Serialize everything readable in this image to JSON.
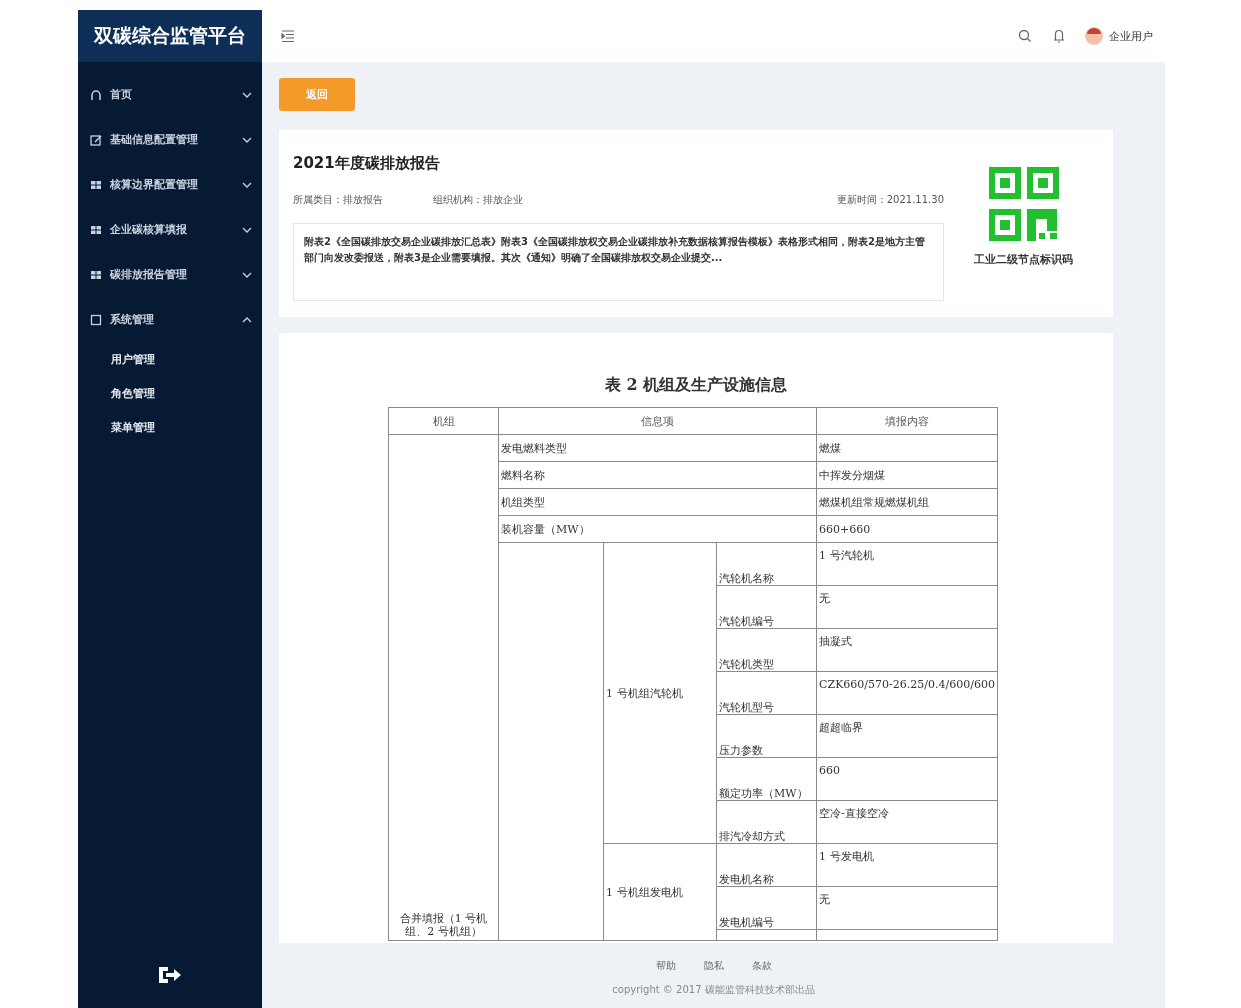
{
  "sidebar": {
    "title": "双碳综合监管平台",
    "items": [
      {
        "label": "首页",
        "expanded": false
      },
      {
        "label": "基础信息配置管理",
        "expanded": false
      },
      {
        "label": "核算边界配置管理",
        "expanded": false
      },
      {
        "label": "企业碳核算填报",
        "expanded": false
      },
      {
        "label": "碳排放报告管理",
        "expanded": false
      },
      {
        "label": "系统管理",
        "expanded": true,
        "children": [
          {
            "label": "用户管理"
          },
          {
            "label": "角色管理"
          },
          {
            "label": "菜单管理"
          }
        ]
      }
    ]
  },
  "header": {
    "user": "企业用户"
  },
  "back_button": "返回",
  "report": {
    "title": "2021年度碳排放报告",
    "category": "所属类目：排放报告",
    "organization": "组织机构：排放企业",
    "updated": "更新时间：2021.11.30",
    "description": "附表2《全国碳排放交易企业碳排放汇总表》附表3《全国碳排放权交易企业碳排放补充数据核算报告模板》表格形式相同，附表2是地方主管部门向发改委报送，附表3是企业需要填报。其次《通知》明确了全国碳排放权交易企业提交...",
    "qr_caption": "工业二级节点标识码"
  },
  "document": {
    "title": "表 2  机组及生产设施信息",
    "columns": [
      "机组",
      "信息项",
      "填报内容"
    ],
    "unit_label": "合并填报（1 号机组、2 号机组）",
    "basic_rows": [
      {
        "item": "发电燃料类型",
        "value": "燃煤"
      },
      {
        "item": "燃料名称",
        "value": "中挥发分烟煤"
      },
      {
        "item": "机组类型",
        "value": "燃煤机组常规燃煤机组"
      },
      {
        "item": "装机容量（MW）",
        "value": "660+660"
      }
    ],
    "components": [
      {
        "name": "1 号机组汽轮机",
        "fields": [
          {
            "item": "汽轮机名称",
            "value": "1 号汽轮机"
          },
          {
            "item": "汽轮机编号",
            "value": "无"
          },
          {
            "item": "汽轮机类型",
            "value": "抽凝式"
          },
          {
            "item": "汽轮机型号",
            "value": "CZK660/570-26.25/0.4/600/600"
          },
          {
            "item": "压力参数",
            "value": "超超临界"
          },
          {
            "item": "额定功率（MW）",
            "value": "660"
          },
          {
            "item": "排汽冷却方式",
            "value": "空冷-直接空冷"
          }
        ]
      },
      {
        "name": "1 号机组发电机",
        "fields": [
          {
            "item": "发电机名称",
            "value": "1 号发电机"
          },
          {
            "item": "发电机编号",
            "value": "无"
          }
        ]
      }
    ]
  },
  "footer": {
    "links": [
      "帮助",
      "隐私",
      "条款"
    ],
    "copyright": "copyright © 2017 碳能监管科技技术部出品"
  }
}
